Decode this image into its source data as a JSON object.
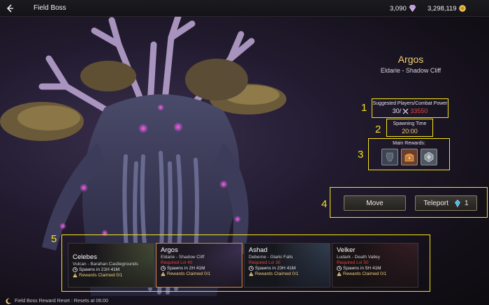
{
  "header": {
    "title": "Field Boss",
    "gems": "3,090",
    "gold": "3,298,119"
  },
  "boss": {
    "name": "Argos",
    "location": "Eldarie - Shadow Cliff",
    "suggested_label": "Suggested Players/Combat Power",
    "players": "30/",
    "combat_power": "33550",
    "spawning_label": "Spawning Time",
    "spawning_time": "20:00",
    "rewards_label": "Main Rewards:"
  },
  "buttons": {
    "move": "Move",
    "teleport": "Teleport",
    "teleport_cost": "1"
  },
  "callouts": [
    "1",
    "2",
    "3",
    "4",
    "5"
  ],
  "cards": [
    {
      "name": "Celebes",
      "location": "Vulcan - Barahan Castlegrounds",
      "required": "",
      "spawn": "Spawns in 21H 41M",
      "rewards": "Rewards Claimed 0/1"
    },
    {
      "name": "Argos",
      "location": "Eldarie - Shadow Cliff",
      "required": "Required Lvl 40",
      "spawn": "Spawns in 2H 41M",
      "rewards": "Rewards Claimed 0/1"
    },
    {
      "name": "Ashad",
      "location": "Deberne - Glarki Falls",
      "required": "Required Lvl 30",
      "spawn": "Spawns in 23H 41M",
      "rewards": "Rewards Claimed 0/1"
    },
    {
      "name": "Velker",
      "location": "Ludark - Death Valley",
      "required": "Required Lvl 50",
      "spawn": "Spawns in 5H 41M",
      "rewards": "Rewards Claimed 0/1"
    }
  ],
  "footer": {
    "text": "Field Boss Reward Reset : Resets at 06:00"
  },
  "icons": {
    "back": "back-arrow-icon",
    "gem": "gem-icon",
    "gold": "gold-coin-icon",
    "combat": "crossed-swords-icon",
    "clock": "clock-icon",
    "warning": "warning-icon",
    "teleport_crystal": "crystal-icon",
    "reward1": "dark-armor-icon",
    "reward2": "treasure-chest-icon",
    "reward3": "silver-crest-icon",
    "footer": "moon-icon"
  },
  "colors": {
    "accent_gold": "#f3cf77",
    "highlight": "#f6e21b",
    "required_red": "#e2473c",
    "selected_border": "#d98a3a"
  }
}
